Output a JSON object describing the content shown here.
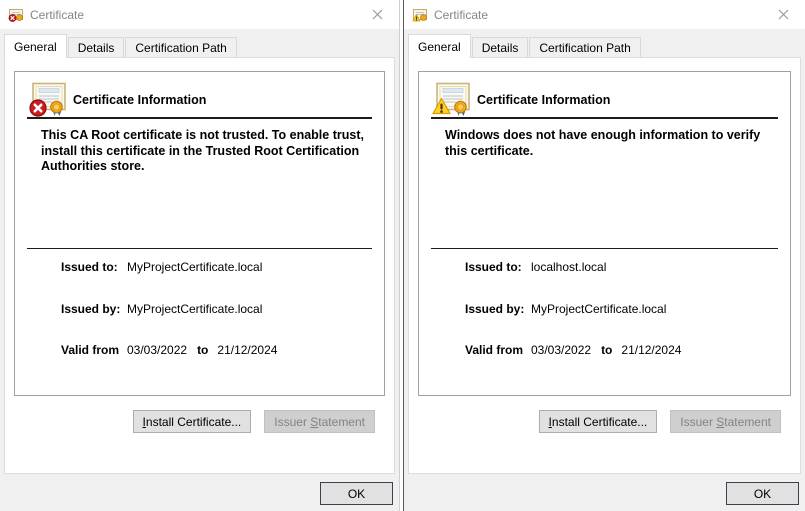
{
  "dialogs": [
    {
      "title": "Certificate",
      "tabs": [
        "General",
        "Details",
        "Certification Path"
      ],
      "active_tab": "General",
      "heading": "Certificate Information",
      "status_icon": "error",
      "status_lines": [
        "This CA Root certificate is not trusted. To enable trust,",
        "install this certificate in the Trusted Root Certification",
        "Authorities store."
      ],
      "fields": {
        "issued_to_label": "Issued to:",
        "issued_to": "MyProjectCertificate.local",
        "issued_by_label": "Issued by:",
        "issued_by": "MyProjectCertificate.local",
        "valid_from_label": "Valid from",
        "valid_from": "03/03/2022",
        "to_word": "to",
        "valid_to": "21/12/2024"
      },
      "buttons": {
        "install": {
          "u": "I",
          "rest": "nstall Certificate..."
        },
        "issuer": {
          "pre": "Issuer ",
          "u": "S",
          "rest": "tatement"
        },
        "ok": "OK"
      }
    },
    {
      "title": "Certificate",
      "tabs": [
        "General",
        "Details",
        "Certification Path"
      ],
      "active_tab": "General",
      "heading": "Certificate Information",
      "status_icon": "warning",
      "status_lines": [
        "Windows does not have enough information to verify",
        "this certificate."
      ],
      "fields": {
        "issued_to_label": "Issued to:",
        "issued_to": "localhost.local",
        "issued_by_label": "Issued by:",
        "issued_by": "MyProjectCertificate.local",
        "valid_from_label": "Valid from",
        "valid_from": "03/03/2022",
        "to_word": "to",
        "valid_to": "21/12/2024"
      },
      "buttons": {
        "install": {
          "u": "I",
          "rest": "nstall Certificate..."
        },
        "issuer": {
          "pre": "Issuer ",
          "u": "S",
          "rest": "tatement"
        },
        "ok": "OK"
      }
    }
  ],
  "colors": {
    "error_badge": "#cf1d1d",
    "warning_badge": "#ffd02c",
    "seal_gold": "#efa51c",
    "dialog_bg": "#f0f0f0",
    "separator": "#1c1c1c"
  }
}
